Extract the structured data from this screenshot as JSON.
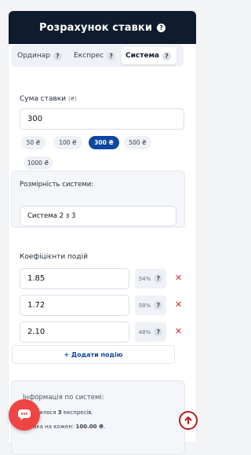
{
  "header": {
    "title": "Розрахунок ставки",
    "help": "?"
  },
  "tabs": [
    {
      "label": "Ординар",
      "help": "?"
    },
    {
      "label": "Експрес",
      "help": "?"
    },
    {
      "label": "Система",
      "help": "?"
    }
  ],
  "active_tab": "Система",
  "stake": {
    "label": "Сума ставки",
    "unit": "(₴)",
    "value": "300"
  },
  "quick_amounts": [
    "50 ₴",
    "100 ₴",
    "300 ₴",
    "500 ₴",
    "1000 ₴"
  ],
  "active_amount": "300 ₴",
  "system": {
    "label": "Розмірність системи:",
    "value": "Система 2 з 3"
  },
  "events": {
    "label": "Коефіцієнти подій",
    "rows": [
      {
        "odds": "1.85",
        "prob": "54%",
        "help": "?",
        "remove": "✕"
      },
      {
        "odds": "1.72",
        "prob": "58%",
        "help": "?",
        "remove": "✕"
      },
      {
        "odds": "2.10",
        "prob": "48%",
        "help": "?",
        "remove": "✕"
      }
    ],
    "add_label": "+ Додати подію"
  },
  "info": {
    "title": "Інформація по системі:",
    "line1_pre": "Утворилося ",
    "line1_bold": "3",
    "line1_post": " експресів.",
    "line2_pre": "Ставка на кожен: ",
    "line2_bold": "100.00 ₴",
    "line2_post": "."
  },
  "colors": {
    "header_bg": "#0f1c2e",
    "accent": "#0d47a1",
    "remove": "#dc2626",
    "chat": "#ef4444"
  }
}
